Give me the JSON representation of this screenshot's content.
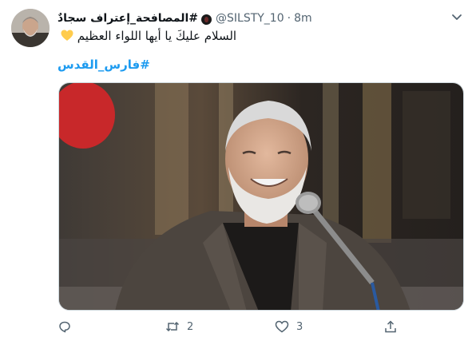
{
  "tweet": {
    "author": {
      "display_name": "#المصافحة_إعتراف سجادٌ",
      "handle": "@SILSTY_10",
      "separator": "·",
      "time": "8m"
    },
    "text": "السلام عليكَ يا أيها اللواء العظيم",
    "emoji": "yellow-heart",
    "hashtag": "#فارس_القدس",
    "stats": {
      "replies": "",
      "retweets": "2",
      "likes": "3"
    }
  },
  "colors": {
    "link_blue": "#1d9bf0",
    "muted_gray": "#536471",
    "heart_yellow": "#ffcc4d"
  },
  "icons": {
    "more": "chevron-down-icon",
    "reply": "reply-icon",
    "retweet": "retweet-icon",
    "like": "like-icon",
    "share": "share-icon"
  }
}
